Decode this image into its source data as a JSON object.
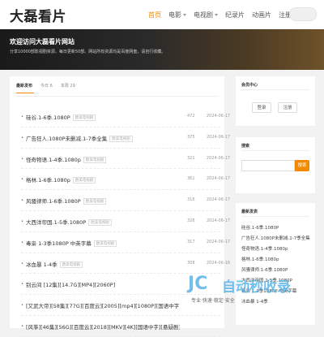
{
  "header": {
    "logo": "大磊看片",
    "nav": [
      {
        "label": "首页",
        "active": true,
        "dropdown": false
      },
      {
        "label": "电影",
        "active": false,
        "dropdown": true
      },
      {
        "label": "电视剧",
        "active": false,
        "dropdown": true
      },
      {
        "label": "纪录片",
        "active": false,
        "dropdown": false
      },
      {
        "label": "动画片",
        "active": false,
        "dropdown": false
      },
      {
        "label": "注册",
        "active": false,
        "dropdown": false
      },
      {
        "label": "登录",
        "active": false,
        "dropdown": false
      }
    ],
    "accent_color": "#f28a00"
  },
  "banner": {
    "title": "欢迎访问大磊看片网站",
    "desc": "分享10000部影视剧资源，每日更新50部。网站所有资源均是百度网盘，请自行收藏。"
  },
  "main": {
    "tabs": [
      {
        "label": "最新发布",
        "active": true
      },
      {
        "label": "今日 6",
        "active": false
      },
      {
        "label": "本周 29",
        "active": false
      }
    ],
    "rows": [
      {
        "title": "硅谷.1-6季.1080P",
        "cat": "欧美电视剧",
        "count": "472",
        "date": "2024-06-17"
      },
      {
        "title": "广告狂人.1080P未删减.1-7季全集",
        "cat": "欧美电视剧",
        "count": "375",
        "date": "2024-06-17"
      },
      {
        "title": "怪奇物语.1-4季.1080p",
        "cat": "欧美电视剧",
        "count": "321",
        "date": "2024-06-17"
      },
      {
        "title": "格林.1-6季.1080p",
        "cat": "欧美电视剧",
        "count": "361",
        "date": "2024-06-17"
      },
      {
        "title": "风骚律师.1-6季.1080P",
        "cat": "欧美电视剧",
        "count": "316",
        "date": "2024-06-17"
      },
      {
        "title": "大西洋帝国.1-5季.1080P",
        "cat": "欧美电视剧",
        "count": "326",
        "date": "2024-06-17"
      },
      {
        "title": "毒枭 1-3季1080P 中英字幕",
        "cat": "欧美电视剧",
        "count": "317",
        "date": "2024-06-17"
      },
      {
        "title": "冰血暴 1-4季",
        "cat": "欧美电视剧",
        "count": "308",
        "date": "2024-06-16"
      },
      {
        "title": "别云间 [12集][14.7G][MP4][2060P]",
        "cat": "",
        "count": "",
        "date": ""
      },
      {
        "title": "[又武大帝][58集][77G][百度云][2005][mp4][1080P][国语中字][历史剧]",
        "cat": "",
        "count": "",
        "date": ""
      },
      {
        "title": "[风筝][46集][56G][百度云][2018][MKV][4K][国语中字][悬疑剧]",
        "cat": "",
        "count": "",
        "date": ""
      }
    ]
  },
  "sidebar": {
    "member": {
      "title": "会员中心",
      "login": "登录",
      "register": "注册"
    },
    "search": {
      "title": "搜索",
      "button": "搜索",
      "placeholder": ""
    },
    "recent": {
      "title": "最新发表",
      "items": [
        "硅谷.1-6季.1080P",
        "广告狂人.1080P未删减.1-7季全集",
        "怪奇物语.1-4季.1080p",
        "格林.1-6季.1080p",
        "风骚律师.1-6季.1080P",
        "大西洋帝国.1-5季.1080P",
        "毒枭 1-3季1080P 中英字幕",
        "冰血暴 1-4季"
      ]
    }
  },
  "watermark": {
    "mark": "JC",
    "text": "自动秒收录",
    "sub": "专业·快速·稳定·安全"
  }
}
